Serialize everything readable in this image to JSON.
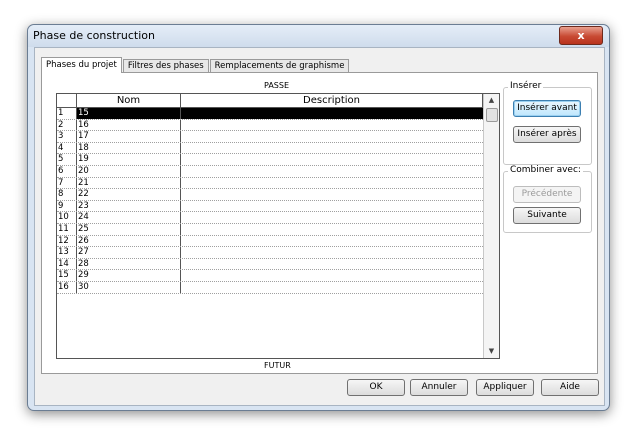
{
  "window": {
    "title": "Phase de construction",
    "close_label": "x"
  },
  "tabs": [
    {
      "label": "Phases du projet",
      "active": true
    },
    {
      "label": "Filtres des phases",
      "active": false
    },
    {
      "label": "Remplacements de graphisme",
      "active": false
    }
  ],
  "panel": {
    "past_label": "PASSE",
    "future_label": "FUTUR"
  },
  "grid": {
    "columns": {
      "name": "Nom",
      "description": "Description"
    },
    "rows": [
      {
        "num": "1",
        "name": "15",
        "description": ""
      },
      {
        "num": "2",
        "name": "16",
        "description": ""
      },
      {
        "num": "3",
        "name": "17",
        "description": ""
      },
      {
        "num": "4",
        "name": "18",
        "description": ""
      },
      {
        "num": "5",
        "name": "19",
        "description": ""
      },
      {
        "num": "6",
        "name": "20",
        "description": ""
      },
      {
        "num": "7",
        "name": "21",
        "description": ""
      },
      {
        "num": "8",
        "name": "22",
        "description": ""
      },
      {
        "num": "9",
        "name": "23",
        "description": ""
      },
      {
        "num": "10",
        "name": "24",
        "description": ""
      },
      {
        "num": "11",
        "name": "25",
        "description": ""
      },
      {
        "num": "12",
        "name": "26",
        "description": ""
      },
      {
        "num": "13",
        "name": "27",
        "description": ""
      },
      {
        "num": "14",
        "name": "28",
        "description": ""
      },
      {
        "num": "15",
        "name": "29",
        "description": ""
      },
      {
        "num": "16",
        "name": "30",
        "description": ""
      }
    ]
  },
  "insert_group": {
    "title": "Insérer",
    "before": "Insérer avant",
    "after": "Insérer après"
  },
  "combine_group": {
    "title": "Combiner avec:",
    "previous": "Précédente",
    "next": "Suivante"
  },
  "footer": {
    "ok": "OK",
    "cancel": "Annuler",
    "apply": "Appliquer",
    "help": "Aide"
  }
}
